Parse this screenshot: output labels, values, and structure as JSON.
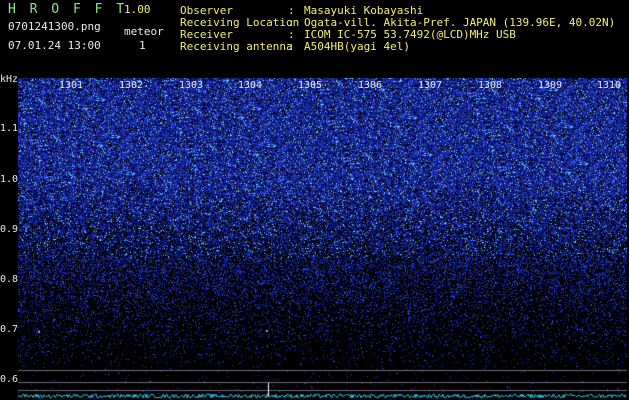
{
  "header": {
    "logo": "H R O F F T",
    "version": "1.00",
    "filename": "0701241300.png",
    "meteor_label": "meteor",
    "datetime": "07.01.24 13:00",
    "meteor_count": "1"
  },
  "info": [
    {
      "key": "Observer",
      "value": "Masayuki Kobayashi"
    },
    {
      "key": "Receiving Location",
      "value": "Ogata-vill. Akita-Pref. JAPAN (139.96E, 40.02N)"
    },
    {
      "key": "Receiver",
      "value": "ICOM IC-575 53.7492(@LCD)MHz USB"
    },
    {
      "key": "Receiving antenna",
      "value": "A504HB(yagi 4el)"
    }
  ],
  "colon": ":",
  "axis": {
    "y_unit": "kHz",
    "y_ticks": [
      "1.1",
      "1.0",
      "0.9",
      "0.8",
      "0.7",
      "0.6"
    ],
    "x_ticks": [
      "1301",
      "1302",
      "1303",
      "1304",
      "1305",
      "1306",
      "1307",
      "1308",
      "1309",
      "1310"
    ]
  },
  "colors": {
    "background": "#000000",
    "spectrum_high": "#9ff0ff",
    "spectrum_mid": "#2f4fd8",
    "spectrum_low": "#0a0f5a",
    "header_text": "#f2ef7a",
    "logo_text": "#8ee58e"
  }
}
